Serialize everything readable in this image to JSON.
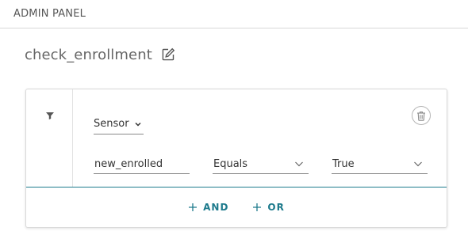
{
  "header": {
    "title": "ADMIN PANEL"
  },
  "page": {
    "title": "check_enrollment",
    "edit_icon": "edit-icon"
  },
  "rule": {
    "filter_icon": "filter-icon",
    "source_select": {
      "value": "Sensor",
      "icon": "chevron-down-icon"
    },
    "delete_icon": "trash-icon",
    "condition": {
      "field": "new_enrolled",
      "operator": "Equals",
      "value": "True"
    }
  },
  "actions": {
    "and_label": "AND",
    "or_label": "OR"
  },
  "colors": {
    "accent": "#1d7a8c",
    "border": "#dadada",
    "text": "#333333",
    "muted_text": "#666666"
  }
}
